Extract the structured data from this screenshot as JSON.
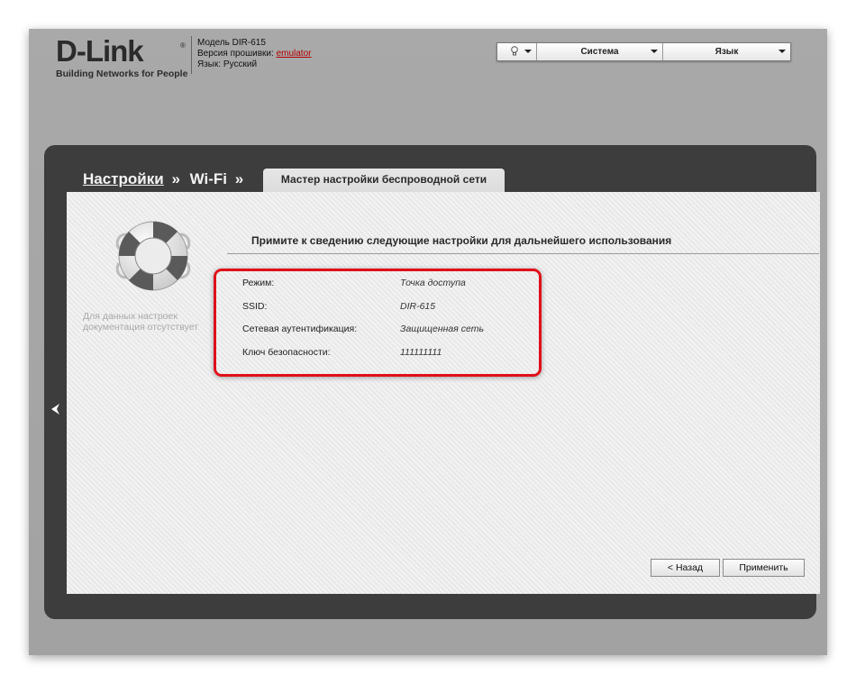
{
  "header": {
    "logo_text": "D-Link",
    "logo_registered": "®",
    "logo_tagline": "Building Networks for People",
    "model_label": "Модель DIR-615",
    "firmware_label": "Версия прошивки: ",
    "firmware_link": "emulator",
    "language_label": "Язык: Русский"
  },
  "toolbar": {
    "items": [
      {
        "label": "",
        "icon": "lightbulb-icon"
      },
      {
        "label": "Система"
      },
      {
        "label": "Язык"
      }
    ]
  },
  "breadcrumb": {
    "settings": "Настройки",
    "separator": "»",
    "wifi": "Wi-Fi",
    "tab": "Мастер настройки беспроводной сети"
  },
  "sidebar": {
    "icon": "lifebuoy-icon",
    "no_doc_line1": "Для данных настроек",
    "no_doc_line2": "документация отсутствует"
  },
  "main": {
    "section_title": "Примите к сведению следующие настройки для дальнейшего использования",
    "rows": [
      {
        "label": "Режим:",
        "value": "Точка доступа"
      },
      {
        "label": "SSID:",
        "value": "DIR-615"
      },
      {
        "label": "Сетевая аутентификация:",
        "value": "Защищенная сеть"
      },
      {
        "label": "Ключ безопасности:",
        "value": "111111111"
      }
    ],
    "highlight_color": "#e0101a"
  },
  "buttons": {
    "back": "< Назад",
    "apply": "Применить"
  }
}
